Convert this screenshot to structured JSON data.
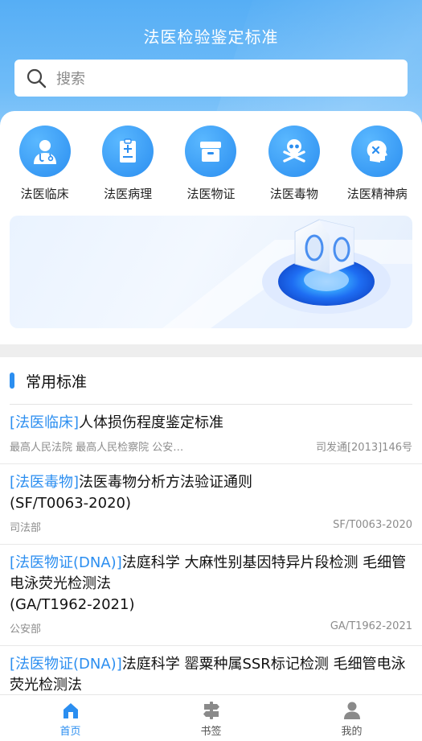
{
  "app": {
    "title": "法医检验鉴定标准"
  },
  "search": {
    "placeholder": "搜索"
  },
  "categories": [
    {
      "label": "法医临床",
      "icon": "doctor-icon"
    },
    {
      "label": "法医病理",
      "icon": "report-icon"
    },
    {
      "label": "法医物证",
      "icon": "evidence-box-icon"
    },
    {
      "label": "法医毒物",
      "icon": "skull-icon"
    },
    {
      "label": "法医精神病",
      "icon": "head-brain-icon"
    }
  ],
  "section": {
    "title": "常用标准"
  },
  "items": [
    {
      "tag": "[法医临床]",
      "title": "人体损伤程度鉴定标准",
      "org": "最高人民法院 最高人民检察院 公安…",
      "code": "司发通[2013]146号"
    },
    {
      "tag": "[法医毒物]",
      "title": "法医毒物分析方法验证通则\n(SF/T0063-2020)",
      "org": "司法部",
      "code": "SF/T0063-2020"
    },
    {
      "tag": "[法医物证(DNA)]",
      "title": "法庭科学 大麻性别基因特异片段检测 毛细管电泳荧光检测法\n(GA/T1962-2021)",
      "org": "公安部",
      "code": "GA/T1962-2021"
    },
    {
      "tag": "[法医物证(DNA)]",
      "title": "法庭科学 罂粟种属SSR标记检测 毛细管电泳荧光检测法",
      "org": "",
      "code": ""
    }
  ],
  "tabs": [
    {
      "label": "首页",
      "icon": "home-icon",
      "active": true
    },
    {
      "label": "书签",
      "icon": "bookmark-icon",
      "active": false
    },
    {
      "label": "我的",
      "icon": "user-icon",
      "active": false
    }
  ],
  "colors": {
    "primary": "#2b8ef0",
    "header": "#56aef5"
  }
}
